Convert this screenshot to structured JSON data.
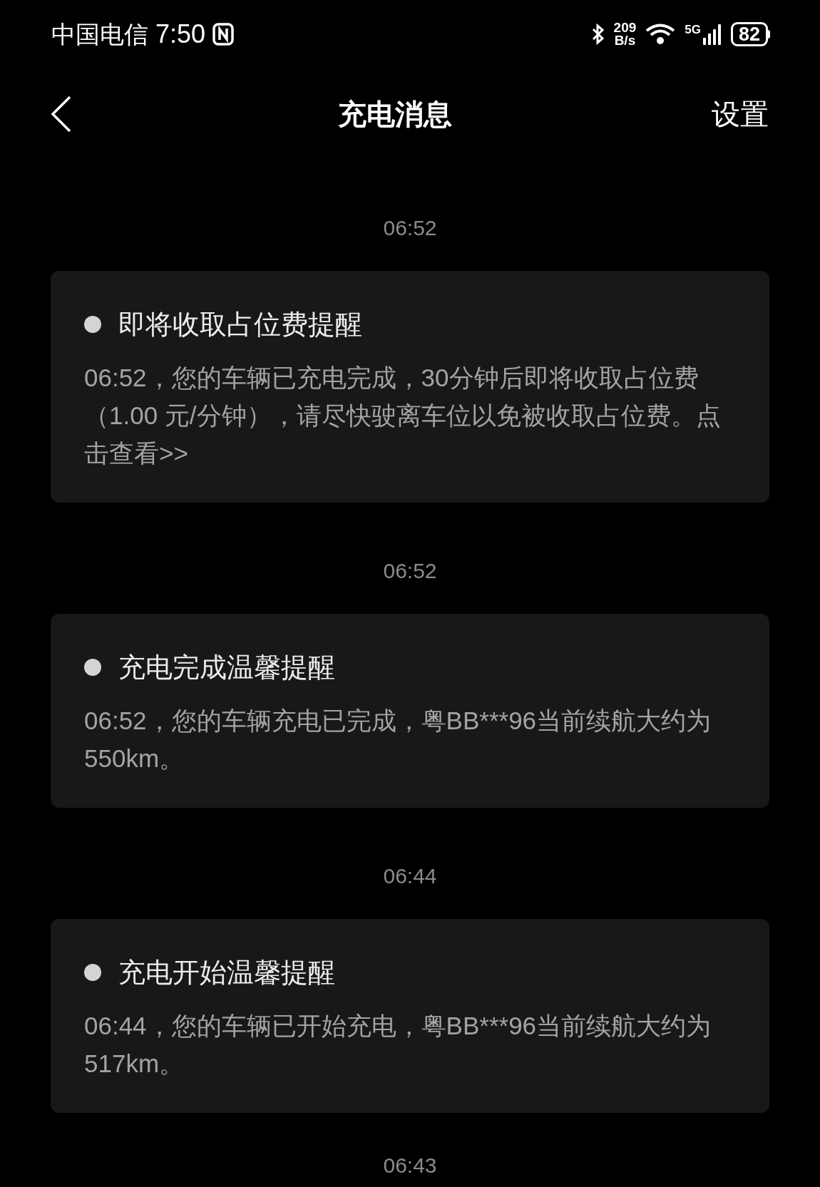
{
  "status_bar": {
    "carrier": "中国电信",
    "time": "7:50",
    "net_speed_value": "209",
    "net_speed_unit": "B/s",
    "network_type": "5G",
    "battery": "82"
  },
  "header": {
    "title": "充电消息",
    "action": "设置"
  },
  "messages": [
    {
      "time": "06:52",
      "title": "即将收取占位费提醒",
      "body": "06:52，您的车辆已充电完成，30分钟后即将收取占位费（1.00 元/分钟），请尽快驶离车位以免被收取占位费。点击查看>>",
      "unread": false
    },
    {
      "time": "06:52",
      "title": "充电完成温馨提醒",
      "body": "06:52，您的车辆充电已完成，粤BB***96当前续航大约为550km。",
      "unread": false
    },
    {
      "time": "06:44",
      "title": "充电开始温馨提醒",
      "body": "06:44，您的车辆已开始充电，粤BB***96当前续航大约为517km。",
      "unread": false
    }
  ],
  "next_time": "06:43"
}
